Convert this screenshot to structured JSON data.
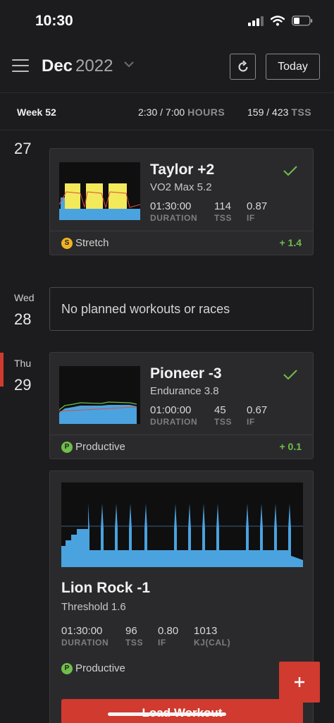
{
  "status": {
    "time": "10:30"
  },
  "header": {
    "month": "Dec",
    "year": "2022",
    "today_label": "Today"
  },
  "week": {
    "label": "Week 52",
    "hours": "2:30 / 7:00",
    "hours_unit": "HOURS",
    "tss": "159 / 423",
    "tss_unit": "TSS"
  },
  "days": [
    {
      "weekday": "",
      "date": "27"
    },
    {
      "weekday": "Wed",
      "date": "28"
    },
    {
      "weekday": "Thu",
      "date": "29"
    }
  ],
  "workouts": [
    {
      "title": "Taylor +2",
      "subtitle": "VO2 Max 5.2",
      "duration": "01:30:00",
      "duration_label": "DURATION",
      "tss": "114",
      "tss_label": "TSS",
      "if": "0.87",
      "if_label": "IF",
      "tag_letter": "S",
      "tag": "Stretch",
      "tag_color": "#f0b323",
      "delta": "+ 1.4"
    },
    {
      "title": "Pioneer -3",
      "subtitle": "Endurance 3.8",
      "duration": "01:00:00",
      "duration_label": "DURATION",
      "tss": "45",
      "tss_label": "TSS",
      "if": "0.67",
      "if_label": "IF",
      "tag_letter": "P",
      "tag": "Productive",
      "tag_color": "#6fbf4a",
      "delta": "+ 0.1"
    }
  ],
  "empty_day": {
    "text": "No planned workouts or races"
  },
  "planned": {
    "title": "Lion Rock -1",
    "subtitle": "Threshold 1.6",
    "duration": "01:30:00",
    "duration_label": "DURATION",
    "tss": "96",
    "tss_label": "TSS",
    "if": "0.80",
    "if_label": "IF",
    "kj": "1013",
    "kj_label": "KJ(CAL)",
    "tag_letter": "P",
    "tag": "Productive",
    "button": "Load Workout"
  },
  "colors": {
    "accent": "#d03a2f",
    "positive": "#6fbf4a",
    "interval_blue": "#4aa3df",
    "interval_yellow": "#f2ea5a"
  }
}
